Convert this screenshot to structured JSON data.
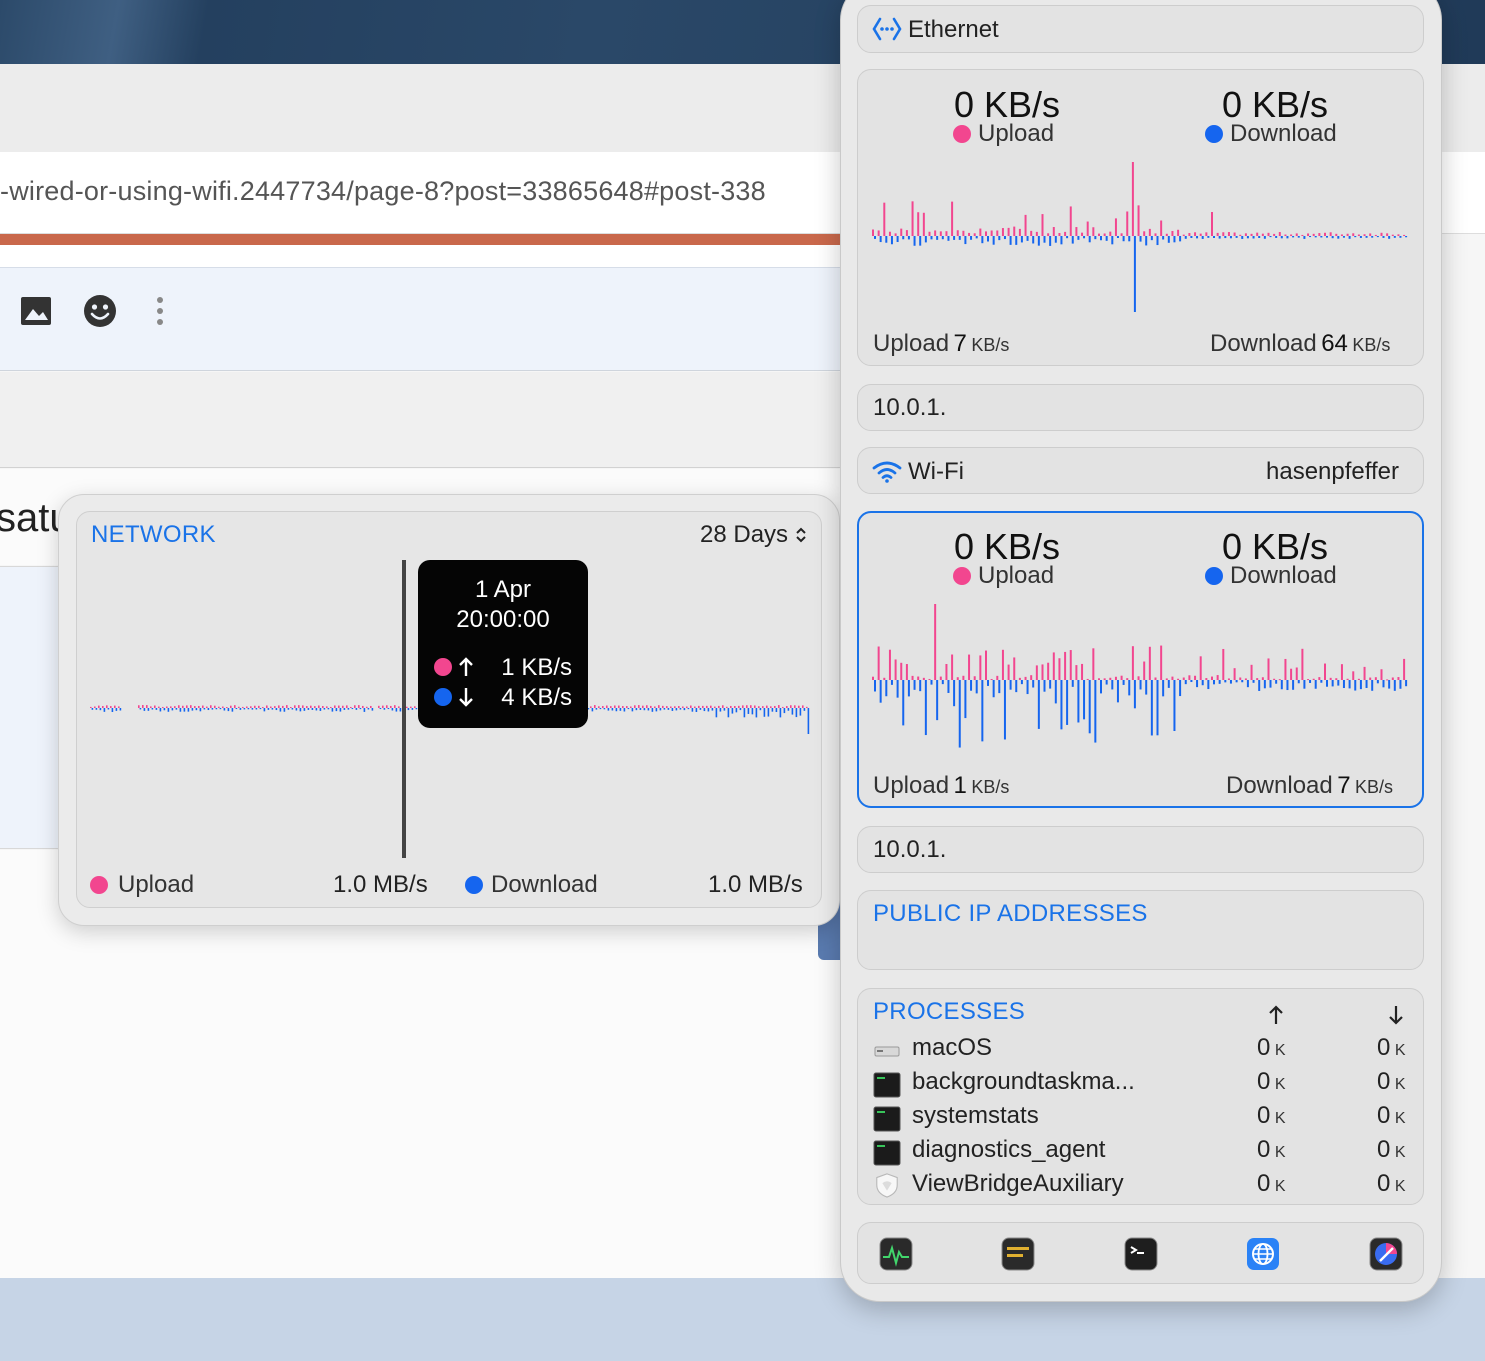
{
  "browser": {
    "url_fragment": "-wired-or-using-wifi.2447734/page-8?post=33865648#post-338",
    "body_text_fragment": "satu",
    "toolbar_icons": [
      "image-icon",
      "emoji-icon",
      "more-vertical-icon"
    ]
  },
  "history_widget": {
    "title": "NETWORK",
    "range": "28 Days",
    "tooltip": {
      "date": "1 Apr",
      "time": "20:00:00",
      "upload_value": "1 KB/s",
      "download_value": "4 KB/s"
    },
    "footer": {
      "upload_label": "Upload",
      "upload_scale": "1.0 MB/s",
      "download_label": "Download",
      "download_scale": "1.0 MB/s"
    }
  },
  "ethernet": {
    "name": "Ethernet",
    "upload_now": "0 KB/s",
    "upload_label": "Upload",
    "download_now": "0 KB/s",
    "download_label": "Download",
    "peak_upload_label": "Upload",
    "peak_upload_value": "7",
    "peak_upload_unit": "KB/s",
    "peak_download_label": "Download",
    "peak_download_value": "64",
    "peak_download_unit": "KB/s",
    "ip": "10.0.1."
  },
  "wifi": {
    "name": "Wi-Fi",
    "ssid": "hasenpfeffer",
    "upload_now": "0 KB/s",
    "upload_label": "Upload",
    "download_now": "0 KB/s",
    "download_label": "Download",
    "peak_upload_label": "Upload",
    "peak_upload_value": "1",
    "peak_upload_unit": "KB/s",
    "peak_download_label": "Download",
    "peak_download_value": "7",
    "peak_download_unit": "KB/s",
    "ip": "10.0.1."
  },
  "public_ip": {
    "title": "PUBLIC IP ADDRESSES"
  },
  "processes": {
    "title": "PROCESSES",
    "up_header": "↑",
    "down_header": "↓",
    "rows": [
      {
        "name": "macOS",
        "up": "0",
        "up_unit": "K",
        "down": "0",
        "down_unit": "K",
        "icon": "macos-icon"
      },
      {
        "name": "backgroundtaskma...",
        "up": "0",
        "up_unit": "K",
        "down": "0",
        "down_unit": "K",
        "icon": "terminal-exec-icon"
      },
      {
        "name": "systemstats",
        "up": "0",
        "up_unit": "K",
        "down": "0",
        "down_unit": "K",
        "icon": "terminal-exec-icon"
      },
      {
        "name": "diagnostics_agent",
        "up": "0",
        "up_unit": "K",
        "down": "0",
        "down_unit": "K",
        "icon": "terminal-exec-icon"
      },
      {
        "name": "ViewBridgeAuxiliary",
        "up": "0",
        "up_unit": "K",
        "down": "0",
        "down_unit": "K",
        "icon": "shield-icon"
      }
    ]
  },
  "dock": [
    "activity-monitor-icon",
    "console-icon",
    "terminal-icon",
    "network-utility-icon",
    "istat-menus-icon"
  ],
  "colors": {
    "upload": "#f2468f",
    "download": "#1565ef",
    "accent": "#1a73e8"
  }
}
